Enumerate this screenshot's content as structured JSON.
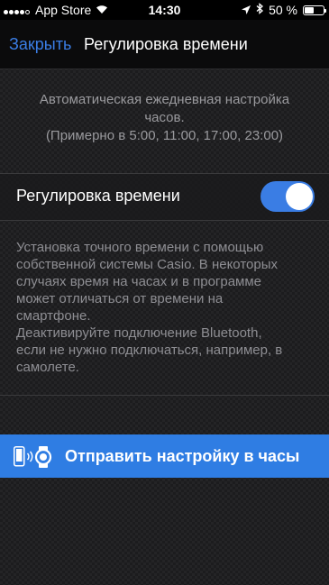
{
  "status_bar": {
    "carrier": "App Store",
    "time": "14:30",
    "battery": "50 %",
    "battery_level": 0.5,
    "icons": [
      "signal-dots-icon",
      "wifi-icon",
      "location-arrow-icon",
      "bluetooth-icon",
      "battery-icon"
    ]
  },
  "nav": {
    "close_label": "Закрыть",
    "title": "Регулировка времени"
  },
  "auto_adjust": {
    "line1": "Автоматическая ежедневная настройка",
    "line2": "часов.",
    "line3": "(Примерно в 5:00, 11:00, 17:00, 23:00)"
  },
  "time_adjust": {
    "label": "Регулировка времени",
    "enabled": true
  },
  "info": {
    "lines": [
      "Установка точного времени с помощью",
      "собственной системы Casio. В некоторых",
      "случаях время на часах и в программе",
      "может отличаться от времени на",
      "смартфоне.",
      "Деактивируйте подключение Bluetooth,",
      "если не нужно подключаться, например, в",
      "самолете."
    ]
  },
  "send_button": {
    "label": "Отправить настройку в часы",
    "icon": "phone-to-watch-icon"
  },
  "colors": {
    "accent": "#2f7de3",
    "link": "#3a7de4",
    "background": "#1c1c1e"
  }
}
